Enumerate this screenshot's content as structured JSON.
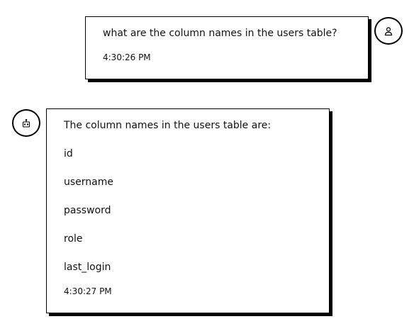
{
  "conversation": {
    "messages": [
      {
        "role": "user",
        "text": "what are the column names in the users table?",
        "timestamp": "4:30:26 PM",
        "avatar_icon": "user-icon"
      },
      {
        "role": "assistant",
        "lines": [
          "The column names in the users table are:",
          "id",
          "username",
          "password",
          "role",
          "last_login"
        ],
        "timestamp": "4:30:27 PM",
        "avatar_icon": "bot-icon"
      }
    ]
  }
}
